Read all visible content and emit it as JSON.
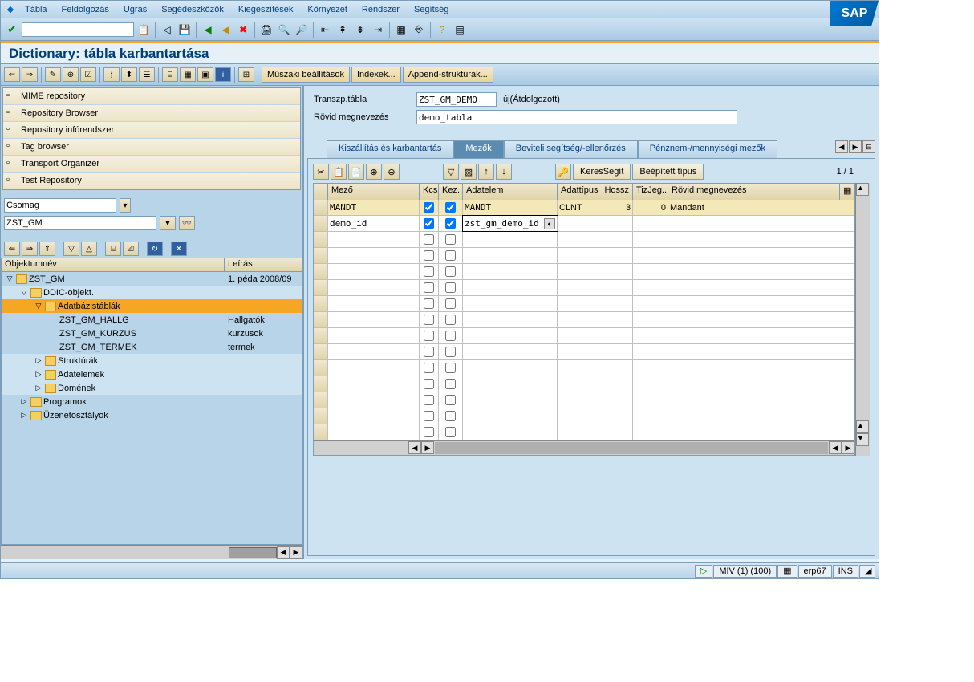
{
  "menubar": {
    "items": [
      "Tábla",
      "Feldolgozás",
      "Ugrás",
      "Segédeszközök",
      "Kiegészítések",
      "Környezet",
      "Rendszer",
      "Segítség"
    ]
  },
  "title": "Dictionary: tábla karbantartása",
  "app_toolbar": {
    "buttons": [
      "Műszaki beállítások",
      "Indexek...",
      "Append-struktúrák..."
    ]
  },
  "repo_items": [
    {
      "label": "MIME repository",
      "icon": "doc-edit"
    },
    {
      "label": "Repository Browser",
      "icon": "tree"
    },
    {
      "label": "Repository infórendszer",
      "icon": "info"
    },
    {
      "label": "Tag browser",
      "icon": "tag"
    },
    {
      "label": "Transport Organizer",
      "icon": "truck"
    },
    {
      "label": "Test Repository",
      "icon": "test"
    }
  ],
  "filter": {
    "type_label": "Csomag",
    "value": "ZST_GM"
  },
  "tree_header": {
    "col1": "Objektumnév",
    "col2": "Leírás"
  },
  "tree": [
    {
      "indent": 0,
      "toggle": "▽",
      "icon": "folder",
      "label": "ZST_GM",
      "desc": "1. péda 2008/09",
      "alt": false
    },
    {
      "indent": 1,
      "toggle": "▽",
      "icon": "folder",
      "label": "DDIC-objekt.",
      "desc": "",
      "alt": true
    },
    {
      "indent": 2,
      "toggle": "▽",
      "icon": "folder-open",
      "label": "Adatbázistáblák",
      "desc": "",
      "sel": true
    },
    {
      "indent": 3,
      "toggle": "",
      "icon": "",
      "label": "ZST_GM_HALLG",
      "desc": "Hallgatók",
      "alt": false
    },
    {
      "indent": 3,
      "toggle": "",
      "icon": "",
      "label": "ZST_GM_KURZUS",
      "desc": "kurzusok",
      "alt": false
    },
    {
      "indent": 3,
      "toggle": "",
      "icon": "",
      "label": "ZST_GM_TERMEK",
      "desc": "termek",
      "alt": false
    },
    {
      "indent": 2,
      "toggle": "▷",
      "icon": "folder",
      "label": "Struktúrák",
      "desc": "",
      "alt": true
    },
    {
      "indent": 2,
      "toggle": "▷",
      "icon": "folder",
      "label": "Adatelemek",
      "desc": "",
      "alt": true
    },
    {
      "indent": 2,
      "toggle": "▷",
      "icon": "folder",
      "label": "Domének",
      "desc": "",
      "alt": true
    },
    {
      "indent": 1,
      "toggle": "▷",
      "icon": "folder",
      "label": "Programok",
      "desc": "",
      "alt": false
    },
    {
      "indent": 1,
      "toggle": "▷",
      "icon": "folder",
      "label": "Üzenetosztályok",
      "desc": "",
      "alt": false
    }
  ],
  "header_fields": {
    "table_label": "Transzp.tábla",
    "table_value": "ZST_GM_DEMO",
    "table_status": "új(Átdolgozott)",
    "desc_label": "Rövid megnevezés",
    "desc_value": "demo_tabla"
  },
  "tabs": [
    "Kiszállítás és karbantartás",
    "Mezők",
    "Beviteli segítség/-ellenőrzés",
    "Pénznem-/mennyiségi mezők"
  ],
  "active_tab": 1,
  "grid_toolbar": {
    "search_btn": "KeresSegít",
    "type_btn": "Beépített típus",
    "page": "1  /  1"
  },
  "grid_header": [
    "Mező",
    "Kcs",
    "Kez...",
    "Adatelem",
    "Adattípus",
    "Hossz",
    "TizJeg...",
    "Rövid megnevezés"
  ],
  "grid_rows": [
    {
      "field": "MANDT",
      "kcs": true,
      "kez": true,
      "elem": "MANDT",
      "type": "CLNT",
      "len": "3",
      "dec": "0",
      "desc": "Mandant",
      "sel": true
    },
    {
      "field": "demo_id",
      "kcs": true,
      "kez": true,
      "elem": "zst_gm_demo_id",
      "type": "",
      "len": "",
      "dec": "",
      "desc": "",
      "editing": true
    }
  ],
  "empty_rows": 13,
  "status": {
    "system": "MIV (1) (100)",
    "server": "erp67",
    "mode": "INS"
  },
  "sap_logo": "SAP"
}
